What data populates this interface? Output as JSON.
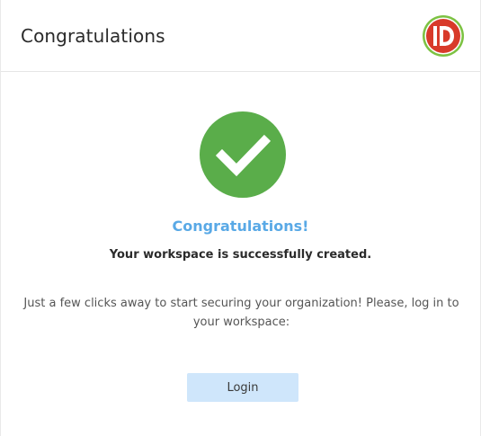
{
  "header": {
    "title": "Congratulations",
    "logo_icon": "id-brand-logo-icon",
    "logo_text": "ID",
    "logo_color": "#d83a2a",
    "logo_ring_color": "#7cc242"
  },
  "main": {
    "status_icon": "checkmark-circle-icon",
    "status_color": "#5aad4a",
    "heading": "Congratulations!",
    "heading_color": "#59a9e6",
    "message": "Your workspace is successfully created.",
    "instructions": "Just a few clicks away to start securing your organization! Please, log in to your workspace:",
    "login_label": "Login",
    "login_bg": "#cfe6fb"
  }
}
